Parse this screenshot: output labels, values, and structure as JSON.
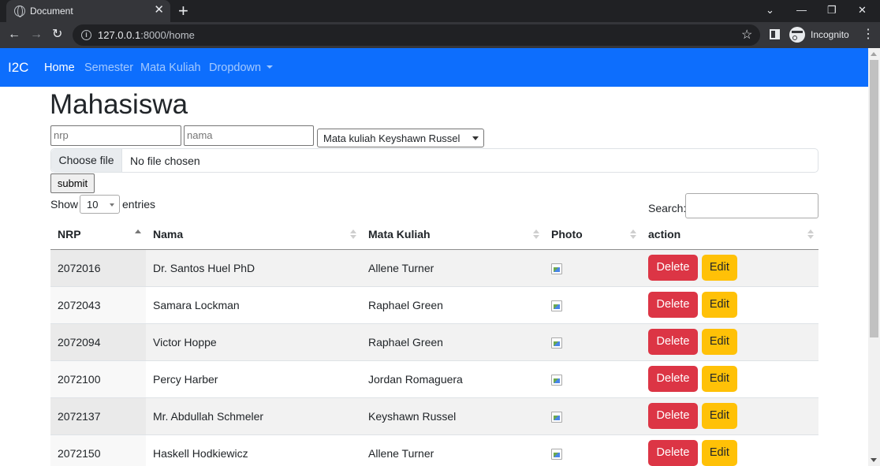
{
  "browser": {
    "tab_title": "Document",
    "url_host": "127.0.0.1",
    "url_rest": ":8000/home",
    "incognito_label": "Incognito"
  },
  "navbar": {
    "brand": "I2C",
    "links": [
      "Home",
      "Semester",
      "Mata Kuliah",
      "Dropdown"
    ]
  },
  "page": {
    "title": "Mahasiswa",
    "form": {
      "nrp_placeholder": "nrp",
      "nama_placeholder": "nama",
      "mata_kuliah_selected": "Mata kuliah Keyshawn Russel",
      "file_button": "Choose file",
      "file_status": "No file chosen",
      "submit_label": "submit"
    },
    "datatable": {
      "show_label": "Show",
      "entries_value": "10",
      "entries_label": "entries",
      "search_label": "Search:",
      "columns": [
        "NRP",
        "Nama",
        "Mata Kuliah",
        "Photo",
        "action"
      ],
      "delete_label": "Delete",
      "edit_label": "Edit",
      "rows": [
        {
          "nrp": "2072016",
          "nama": "Dr. Santos Huel PhD",
          "mata_kuliah": "Allene Turner"
        },
        {
          "nrp": "2072043",
          "nama": "Samara Lockman",
          "mata_kuliah": "Raphael Green"
        },
        {
          "nrp": "2072094",
          "nama": "Victor Hoppe",
          "mata_kuliah": "Raphael Green"
        },
        {
          "nrp": "2072100",
          "nama": "Percy Harber",
          "mata_kuliah": "Jordan Romaguera"
        },
        {
          "nrp": "2072137",
          "nama": "Mr. Abdullah Schmeler",
          "mata_kuliah": "Keyshawn Russel"
        },
        {
          "nrp": "2072150",
          "nama": "Haskell Hodkiewicz",
          "mata_kuliah": "Allene Turner"
        }
      ]
    }
  },
  "colors": {
    "navbar": "#0d6efd",
    "delete": "#dc3545",
    "edit": "#ffc107"
  }
}
